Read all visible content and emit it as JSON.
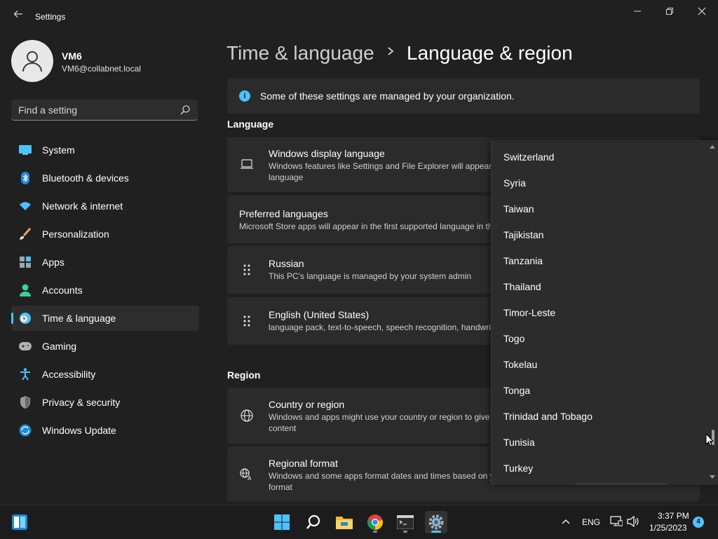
{
  "window": {
    "title": "Settings",
    "controls": [
      "minimize",
      "restore",
      "close"
    ]
  },
  "profile": {
    "name": "VM6",
    "email": "VM6@collabnet.local"
  },
  "search": {
    "placeholder": "Find a setting"
  },
  "nav": {
    "items": [
      {
        "label": "System",
        "icon": "system-icon"
      },
      {
        "label": "Bluetooth & devices",
        "icon": "bluetooth-icon"
      },
      {
        "label": "Network & internet",
        "icon": "wifi-icon"
      },
      {
        "label": "Personalization",
        "icon": "brush-icon"
      },
      {
        "label": "Apps",
        "icon": "apps-icon"
      },
      {
        "label": "Accounts",
        "icon": "person-icon"
      },
      {
        "label": "Time & language",
        "icon": "clock-globe-icon",
        "active": true
      },
      {
        "label": "Gaming",
        "icon": "gamepad-icon"
      },
      {
        "label": "Accessibility",
        "icon": "accessibility-icon"
      },
      {
        "label": "Privacy & security",
        "icon": "shield-icon"
      },
      {
        "label": "Windows Update",
        "icon": "update-icon"
      }
    ]
  },
  "breadcrumb": {
    "parent": "Time & language",
    "separator": ">",
    "current": "Language & region"
  },
  "info_bar": {
    "text": "Some of these settings are managed by your organization."
  },
  "language_section": {
    "heading": "Language",
    "display_language": {
      "title": "Windows display language",
      "desc_line1": "Windows features like Settings and File Explorer will appear in this",
      "desc_line2": "language"
    },
    "preferred": {
      "title": "Preferred languages",
      "desc": "Microsoft Store apps will appear in the first supported language in this list"
    },
    "languages": [
      {
        "title": "Russian",
        "desc": "This PC's language is managed by your system admin"
      },
      {
        "title": "English (United States)",
        "desc": "language pack, text-to-speech, speech recognition, handwriting"
      }
    ]
  },
  "region_section": {
    "heading": "Region",
    "country": {
      "title": "Country or region",
      "desc_line1": "Windows and apps might use your country or region to give you local",
      "desc_line2": "content"
    },
    "format": {
      "title": "Regional format",
      "desc_line1": "Windows and some apps format dates and times based on your regional",
      "desc_line2": "format"
    }
  },
  "dropdown": {
    "items": [
      "Switzerland",
      "Syria",
      "Taiwan",
      "Tajikistan",
      "Tanzania",
      "Thailand",
      "Timor-Leste",
      "Togo",
      "Tokelau",
      "Tonga",
      "Trinidad and Tobago",
      "Tunisia",
      "Turkey"
    ]
  },
  "taskbar": {
    "apps": [
      "start-icon",
      "search-icon",
      "file-explorer-icon",
      "chrome-icon",
      "terminal-icon",
      "settings-icon"
    ],
    "language": "ENG",
    "time": "3:37 PM",
    "date": "1/25/2023",
    "notification_count": "4"
  },
  "colors": {
    "accent": "#4cc2ff",
    "background": "#202020",
    "card": "#2b2b2b"
  }
}
